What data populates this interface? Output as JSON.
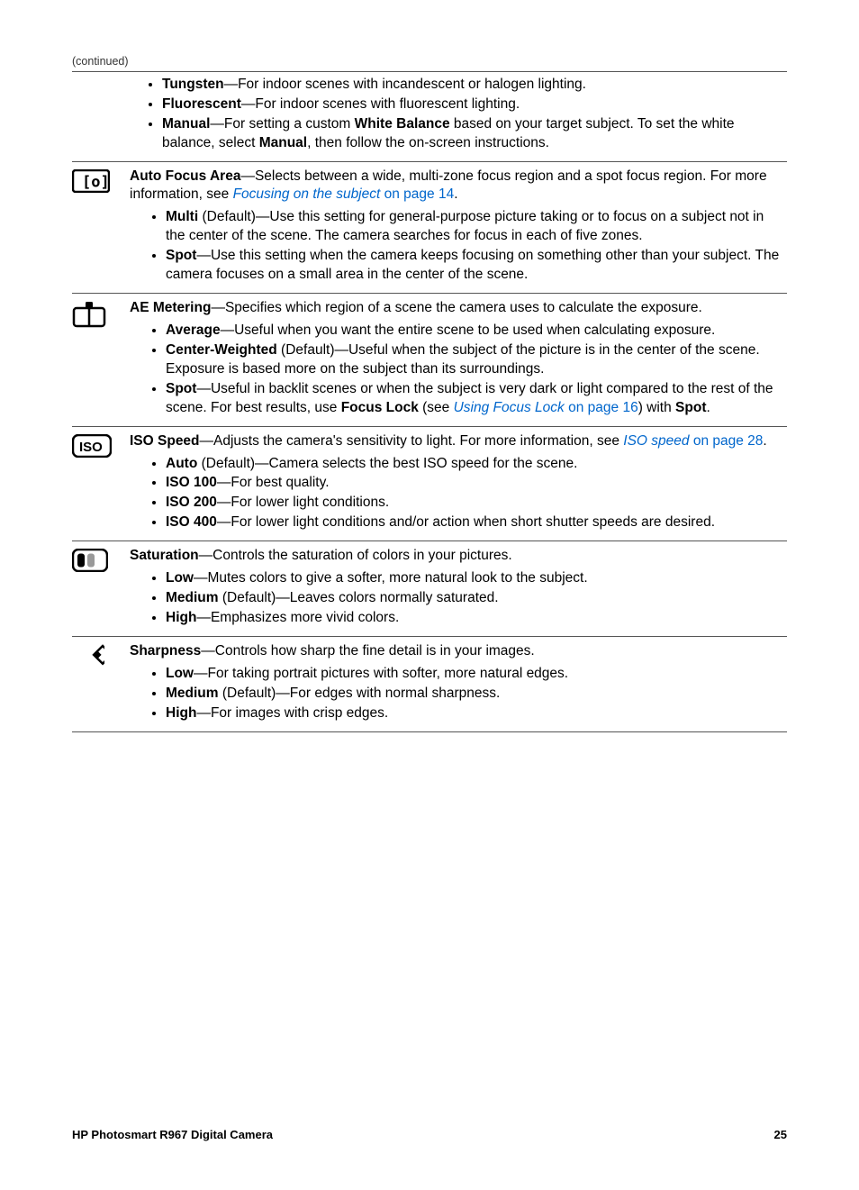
{
  "continued": "(continued)",
  "sec0": {
    "items": [
      {
        "b": "Tungsten",
        "t": "—For indoor scenes with incandescent or halogen lighting."
      },
      {
        "b": "Fluorescent",
        "t": "—For indoor scenes with fluorescent lighting."
      },
      {
        "b": "Manual",
        "t_pre": "—For setting a custom ",
        "b2": "White Balance",
        "t_mid": " based on your target subject. To set the white balance, select ",
        "b3": "Manual",
        "t_post": ", then follow the on-screen instructions."
      }
    ]
  },
  "sec1": {
    "title": "Auto Focus Area",
    "desc1": "—Selects between a wide, multi-zone focus region and a spot focus region. For more information, see ",
    "link_i": "Focusing on the subject",
    "link_p": " on page 14",
    "desc2": ".",
    "items": [
      {
        "b": "Multi",
        "t": " (Default)—Use this setting for general-purpose picture taking or to focus on a subject not in the center of the scene. The camera searches for focus in each of five zones."
      },
      {
        "b": "Spot",
        "t": "—Use this setting when the camera keeps focusing on something other than your subject. The camera focuses on a small area in the center of the scene."
      }
    ]
  },
  "sec2": {
    "title": "AE Metering",
    "desc": "—Specifies which region of a scene the camera uses to calculate the exposure.",
    "items": [
      {
        "b": "Average",
        "t": "—Useful when you want the entire scene to be used when calculating exposure."
      },
      {
        "b": "Center-Weighted",
        "t": " (Default)—Useful when the subject of the picture is in the center of the scene. Exposure is based more on the subject than its surroundings."
      },
      {
        "b": "Spot",
        "t_pre": "—Useful in backlit scenes or when the subject is very dark or light compared to the rest of the scene. For best results, use ",
        "b2": "Focus Lock",
        "t_mid": " (see ",
        "link_i": "Using Focus Lock",
        "link_p": " on page 16",
        "t_post": ") with ",
        "b3": "Spot",
        "t_end": "."
      }
    ]
  },
  "sec3": {
    "title": "ISO Speed",
    "desc1": "—Adjusts the camera's sensitivity to light. For more information, see ",
    "link_i": "ISO speed",
    "link_p": " on page 28",
    "desc2": ".",
    "items": [
      {
        "b": "Auto",
        "t": " (Default)—Camera selects the best ISO speed for the scene."
      },
      {
        "b": "ISO 100",
        "t": "—For best quality."
      },
      {
        "b": "ISO 200",
        "t": "—For lower light conditions."
      },
      {
        "b": "ISO 400",
        "t": "—For lower light conditions and/or action when short shutter speeds are desired."
      }
    ]
  },
  "sec4": {
    "title": "Saturation",
    "desc": "—Controls the saturation of colors in your pictures.",
    "items": [
      {
        "b": "Low",
        "t": "—Mutes colors to give a softer, more natural look to the subject."
      },
      {
        "b": "Medium",
        "t": " (Default)—Leaves colors normally saturated."
      },
      {
        "b": "High",
        "t": "—Emphasizes more vivid colors."
      }
    ]
  },
  "sec5": {
    "title": "Sharpness",
    "desc": "—Controls how sharp the fine detail is in your images.",
    "items": [
      {
        "b": "Low",
        "t": "—For taking portrait pictures with softer, more natural edges."
      },
      {
        "b": "Medium",
        "t": " (Default)—For edges with normal sharpness."
      },
      {
        "b": "High",
        "t": "—For images with crisp edges."
      }
    ]
  },
  "footer": {
    "left": "HP Photosmart R967 Digital Camera",
    "right": "25"
  }
}
